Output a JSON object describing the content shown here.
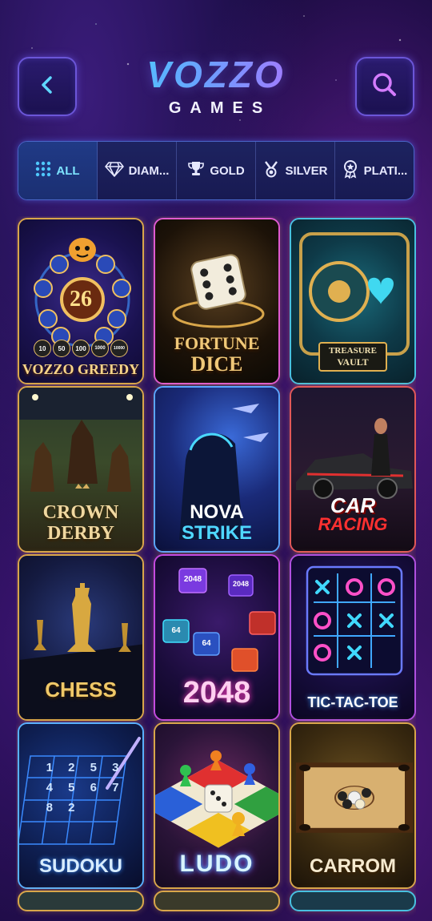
{
  "header": {
    "logo_main": "VOZZO",
    "logo_sub": "GAMES",
    "back_icon": "chevron-left-icon",
    "search_icon": "search-icon"
  },
  "filters": [
    {
      "label": "ALL",
      "icon": "grid-icon",
      "active": true
    },
    {
      "label": "DIAM...",
      "icon": "diamond-icon",
      "active": false
    },
    {
      "label": "GOLD",
      "icon": "trophy-icon",
      "active": false
    },
    {
      "label": "SILVER",
      "icon": "medal-icon",
      "active": false
    },
    {
      "label": "PLATI...",
      "icon": "award-icon",
      "active": false
    }
  ],
  "games": [
    {
      "title": "VOZZO GREEDY",
      "badge": "26",
      "chips": [
        "10",
        "50",
        "100",
        "1000",
        "10000"
      ]
    },
    {
      "title_line1": "FORTUNE",
      "title_line2": "DICE"
    },
    {
      "title_line1": "TREASURE",
      "title_line2": "VAULT"
    },
    {
      "title_line1": "CROWN",
      "title_line2": "DERBY"
    },
    {
      "title_line1": "NOVA",
      "title_line2": "STRIKE"
    },
    {
      "title_line1": "CAR",
      "title_line2": "RACING"
    },
    {
      "title": "CHESS"
    },
    {
      "title": "2048",
      "tiles": [
        "2048",
        "2048",
        "64",
        "64"
      ]
    },
    {
      "title": "TIC-TAC-TOE"
    },
    {
      "title": "SUDOKU",
      "digits": [
        "1",
        "2",
        "5",
        "3",
        "4",
        "5",
        "6",
        "7",
        "8",
        "2"
      ]
    },
    {
      "title": "LUDO"
    },
    {
      "title": "CARROM"
    }
  ],
  "colors": {
    "accent_cyan": "#3fe3ff",
    "accent_purple": "#c66aff",
    "gold": "#e8c06a"
  }
}
